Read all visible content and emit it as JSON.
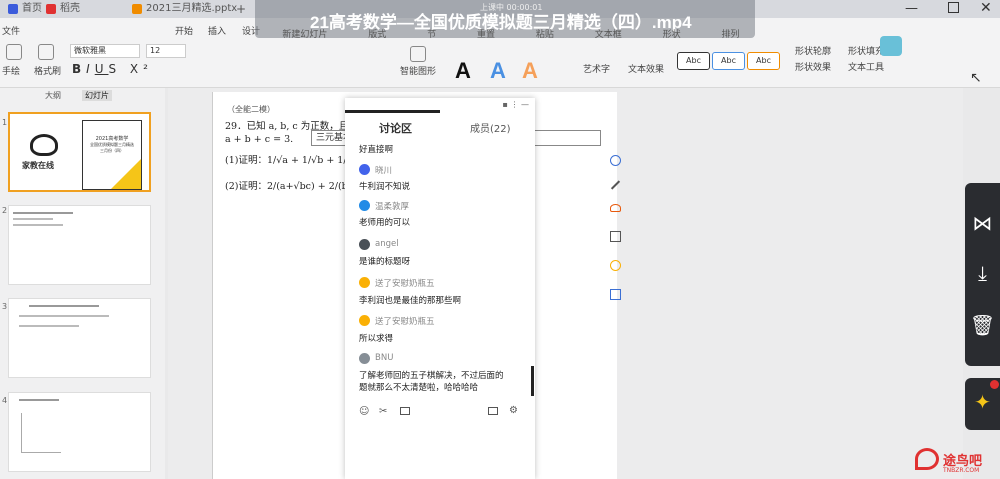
{
  "tabs": [
    {
      "label": "首页",
      "color": "#3b5bdb"
    },
    {
      "label": "稻壳",
      "color": "#e03131"
    },
    {
      "label": "2021三月精选.pptx",
      "color": "#f08c00"
    }
  ],
  "video_title": "21高考数学—全国优质模拟题三月精选（四）.mp4",
  "recording": "上课中 00:00:01",
  "ribbon": {
    "menu": [
      "文件",
      "开始",
      "插入",
      "设计"
    ],
    "font_name": "微软雅黑",
    "font_size": "12",
    "labels": [
      "手绘",
      "格式刷",
      "新建幻灯片",
      "版式",
      "节",
      "重置",
      "粘贴",
      "文本框",
      "形状",
      "排列",
      "智能图形",
      "艺术字",
      "文本效果",
      "文本工具",
      "形状轮廓",
      "形状效果",
      "形状填充"
    ],
    "style_boxes": [
      "Abc",
      "Abc",
      "Abc"
    ],
    "big_letters": [
      "A",
      "A",
      "A"
    ]
  },
  "left_tabs": [
    "大纲",
    "幻灯片"
  ],
  "slide_numbers": [
    "1",
    "2",
    "3",
    "4"
  ],
  "slide1": {
    "logo_text": "家教在线",
    "title_lines": [
      "2021高考数学",
      "全国优质模拟题三月精选",
      "三月份（四）"
    ]
  },
  "doc": {
    "header": "（全能二模）",
    "q": "29．已知 a, b, c 为正数，且满足",
    "cond": "a + b + c = 3.",
    "p1": "(1)证明：1/√a + 1/√b + 1/√c ≥ 3;",
    "p2": "(2)证明：2/(a+√bc) + 2/(b+√ac) + 2/(c+√ab) ≥ 3.",
    "box_text": "三元基本"
  },
  "chat": {
    "tab_discuss": "讨论区",
    "tab_members": "成员(22)",
    "messages": [
      {
        "name": "",
        "text": "好直接啊",
        "avatar": ""
      },
      {
        "name": "晓川",
        "text": "牛利润不知说",
        "avatar": "#4263eb"
      },
      {
        "name": "温柔敦厚",
        "text": "老师用的可以",
        "avatar": "#228be6"
      },
      {
        "name": "angel",
        "text": "是谁的标题呀",
        "avatar": "#495057"
      },
      {
        "name": "送了安慰奶瓶五",
        "text": "李利润也是最佳的那那些啊",
        "avatar": "#fab005"
      },
      {
        "name": "送了安慰奶瓶五",
        "text": "所以求得",
        "avatar": "#fab005"
      },
      {
        "name": "BNU",
        "text": "了解老师回的五子棋解决，不过后面的题就那么不太清楚啦，哈哈哈哈",
        "avatar": "#868e96"
      }
    ]
  },
  "watermark": "途鸟吧",
  "watermark_sub": "TNBZR.COM"
}
